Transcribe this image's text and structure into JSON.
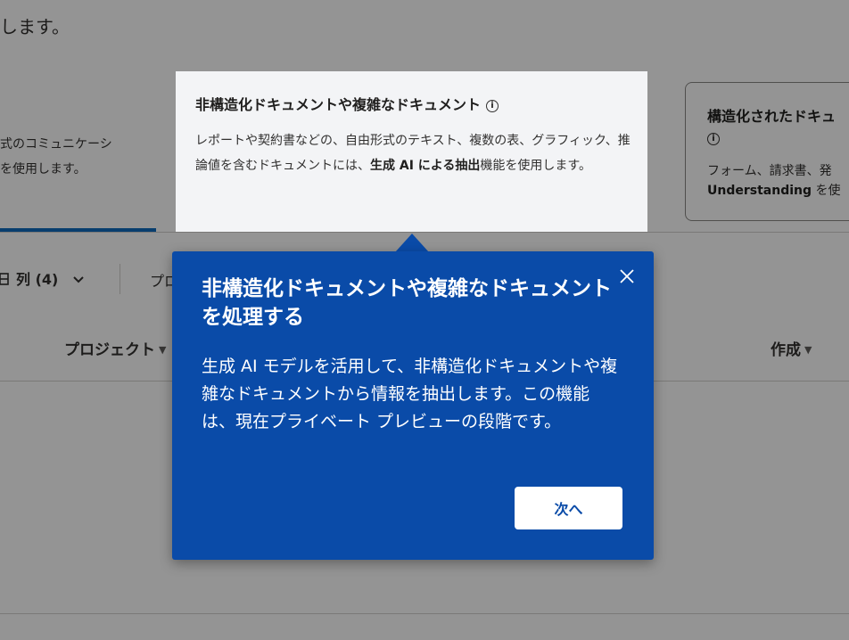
{
  "page": {
    "intro_text": "します。"
  },
  "cards": {
    "left": {
      "desc_line1": "式のコミュニケーシ",
      "desc_line2": "を使用します。"
    },
    "middle": {
      "title": "非構造化ドキュメントや複雑なドキュメント",
      "desc_part1": "レポートや契約書などの、自由形式のテキスト、複数の表、グラフィック、推論値を含むドキュメントには、",
      "desc_bold": "生成 AI による抽出",
      "desc_part2": "機能を使用します。"
    },
    "right": {
      "title": "構造化されたドキュ",
      "desc_line1": "フォーム、請求書、発",
      "desc_bold": "Understanding",
      "desc_line2_rest": " を使"
    }
  },
  "toolbar": {
    "columns_label": "列 (4)",
    "partial_label": "プロ"
  },
  "table": {
    "columns": [
      "プロジェクト",
      "作成"
    ]
  },
  "popover": {
    "title": "非構造化ドキュメントや複雑なドキュメントを処理する",
    "body": "生成 AI モデルを活用して、非構造化ドキュメントや複雑なドキュメントから情報を抽出します。この機能は、現在プライベート プレビューの段階です。",
    "next_label": "次へ"
  },
  "colors": {
    "accent": "#0a4ba8",
    "card_bg": "#f3f4f6",
    "selected_border": "#0f6cbd"
  }
}
